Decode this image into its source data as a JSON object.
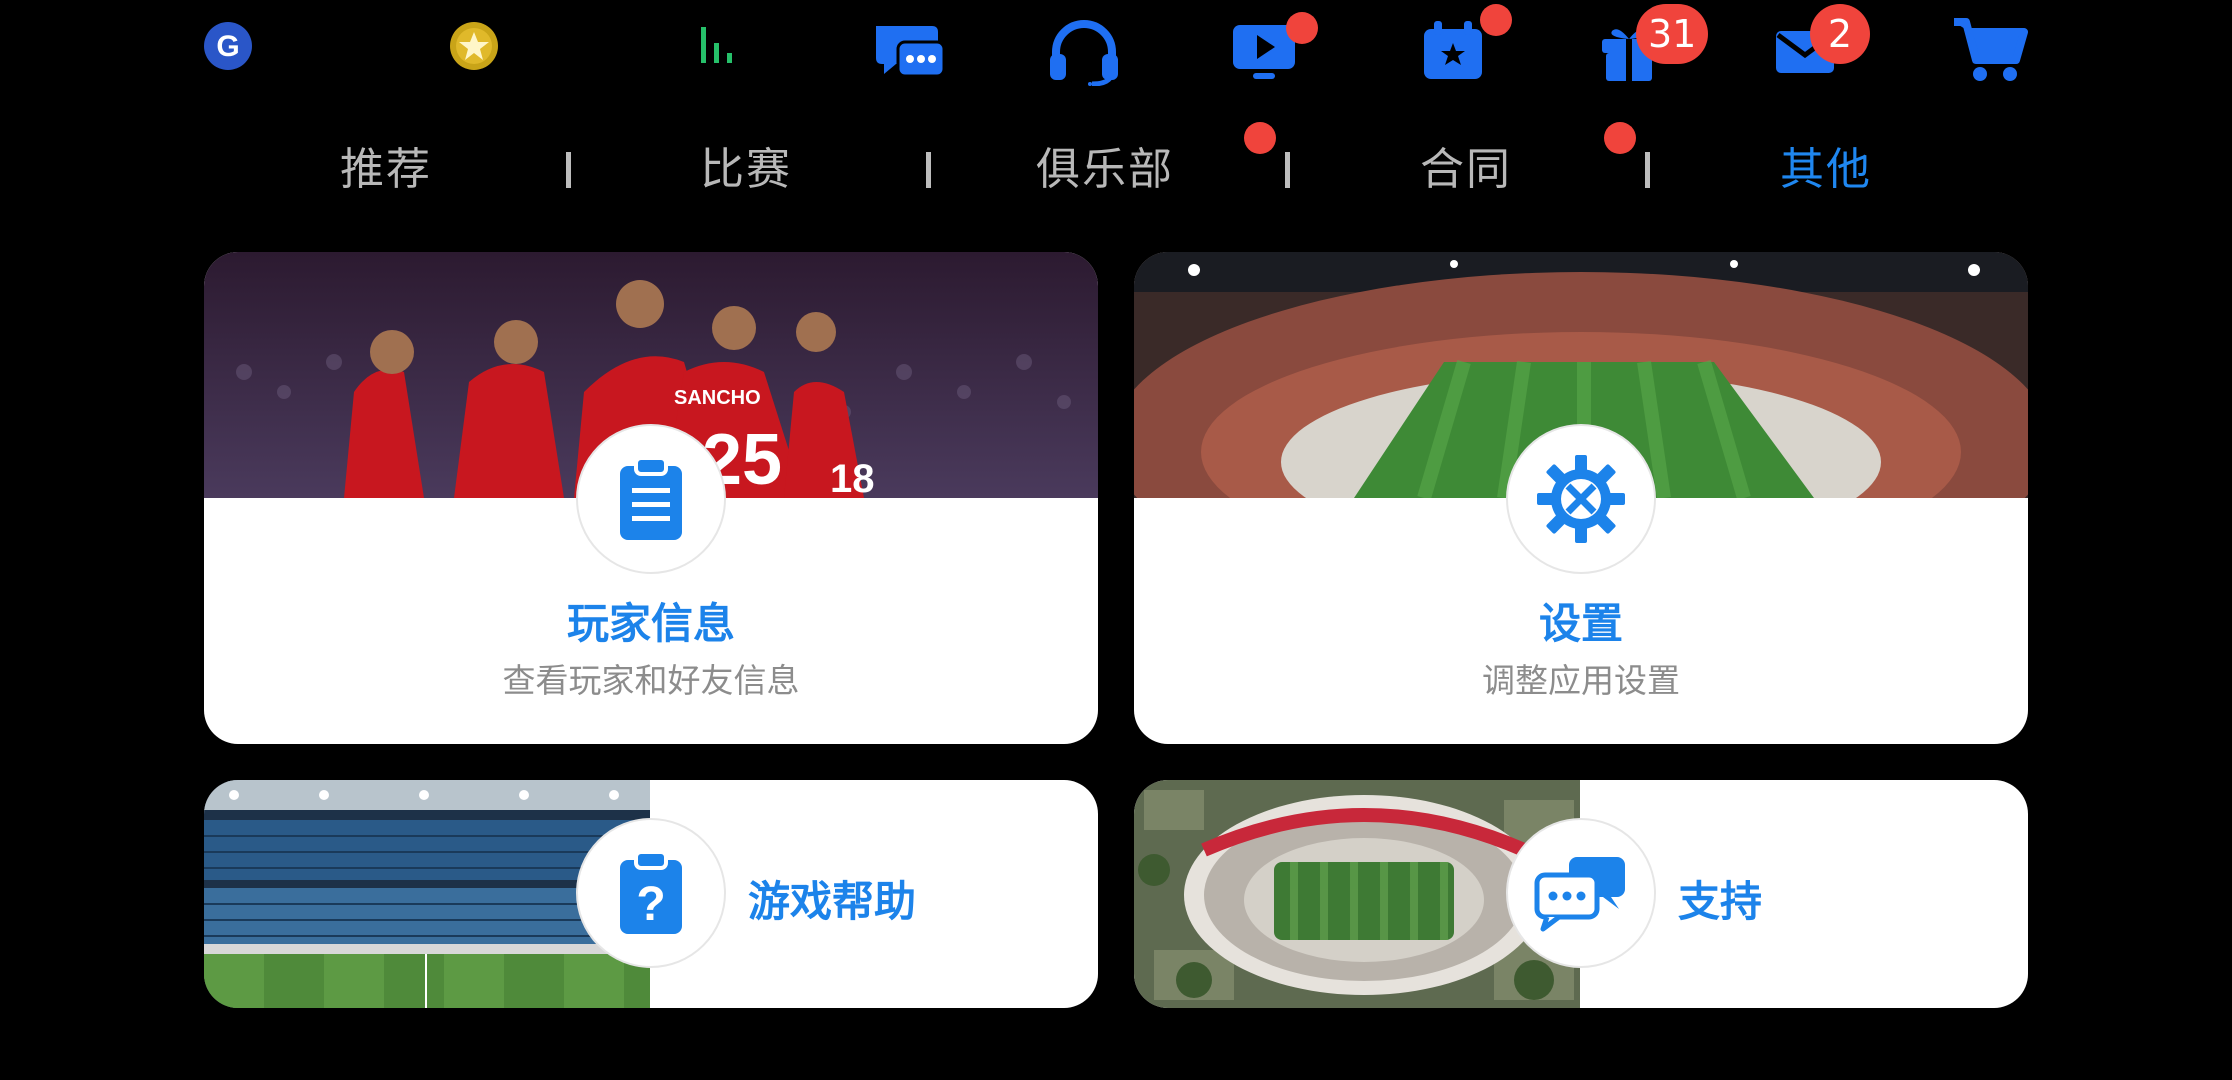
{
  "top_bar": {
    "icons": [
      {
        "name": "google-icon"
      },
      {
        "name": "coin-icon"
      },
      {
        "name": "signal-bars-icon"
      },
      {
        "name": "chat-icon"
      },
      {
        "name": "headset-icon"
      },
      {
        "name": "video-icon",
        "dot": true
      },
      {
        "name": "calendar-icon",
        "dot": true
      },
      {
        "name": "gift-icon",
        "badge": "31"
      },
      {
        "name": "mail-icon",
        "badge": "2"
      },
      {
        "name": "cart-icon"
      }
    ]
  },
  "tabs": [
    {
      "label": "推荐",
      "active": false,
      "dot": false
    },
    {
      "label": "比赛",
      "active": false,
      "dot": false
    },
    {
      "label": "俱乐部",
      "active": false,
      "dot": true
    },
    {
      "label": "合同",
      "active": false,
      "dot": true
    },
    {
      "label": "其他",
      "active": true,
      "dot": false
    }
  ],
  "cards": {
    "player_info": {
      "title": "玩家信息",
      "subtitle": "查看玩家和好友信息",
      "icon": "clipboard-icon"
    },
    "settings": {
      "title": "设置",
      "subtitle": "调整应用设置",
      "icon": "gear-icon"
    },
    "game_help": {
      "title": "游戏帮助",
      "icon": "help-clipboard-icon"
    },
    "support": {
      "title": "支持",
      "icon": "support-chat-icon"
    }
  },
  "colors": {
    "accent": "#1c83ea",
    "badge": "#f0443c",
    "background": "#000000"
  }
}
